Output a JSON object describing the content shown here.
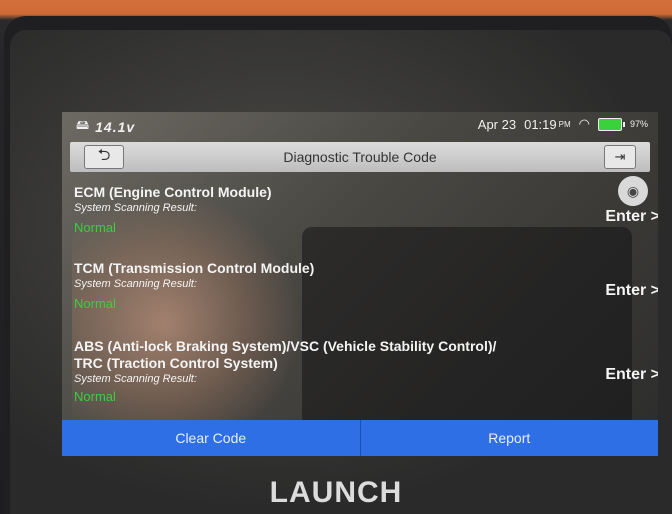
{
  "status_bar": {
    "voltage": "14.1v",
    "date": "Apr 23",
    "time": "01:19",
    "ampm": "PM",
    "battery": "97%"
  },
  "header": {
    "title": "Diagnostic Trouble Code",
    "back_icon": "back-arrow-icon",
    "exit_icon": "exit-door-icon"
  },
  "modules": [
    {
      "name": "ECM (Engine Control Module)",
      "label": "System Scanning Result:",
      "status": "Normal",
      "enter": "Enter >"
    },
    {
      "name": "TCM (Transmission Control Module)",
      "label": "System Scanning Result:",
      "status": "Normal",
      "enter": "Enter >"
    },
    {
      "name_line1": "ABS (Anti-lock Braking System)/VSC (Vehicle Stability Control)/",
      "name_line2": "TRC (Traction Control System)",
      "label": "System Scanning Result:",
      "status": "Normal",
      "enter": "Enter >"
    }
  ],
  "actions": {
    "clear_code": "Clear Code",
    "report": "Report"
  },
  "brand": "LAUNCH",
  "colors": {
    "accent": "#2f6fe6",
    "status_normal": "#37d13f"
  }
}
